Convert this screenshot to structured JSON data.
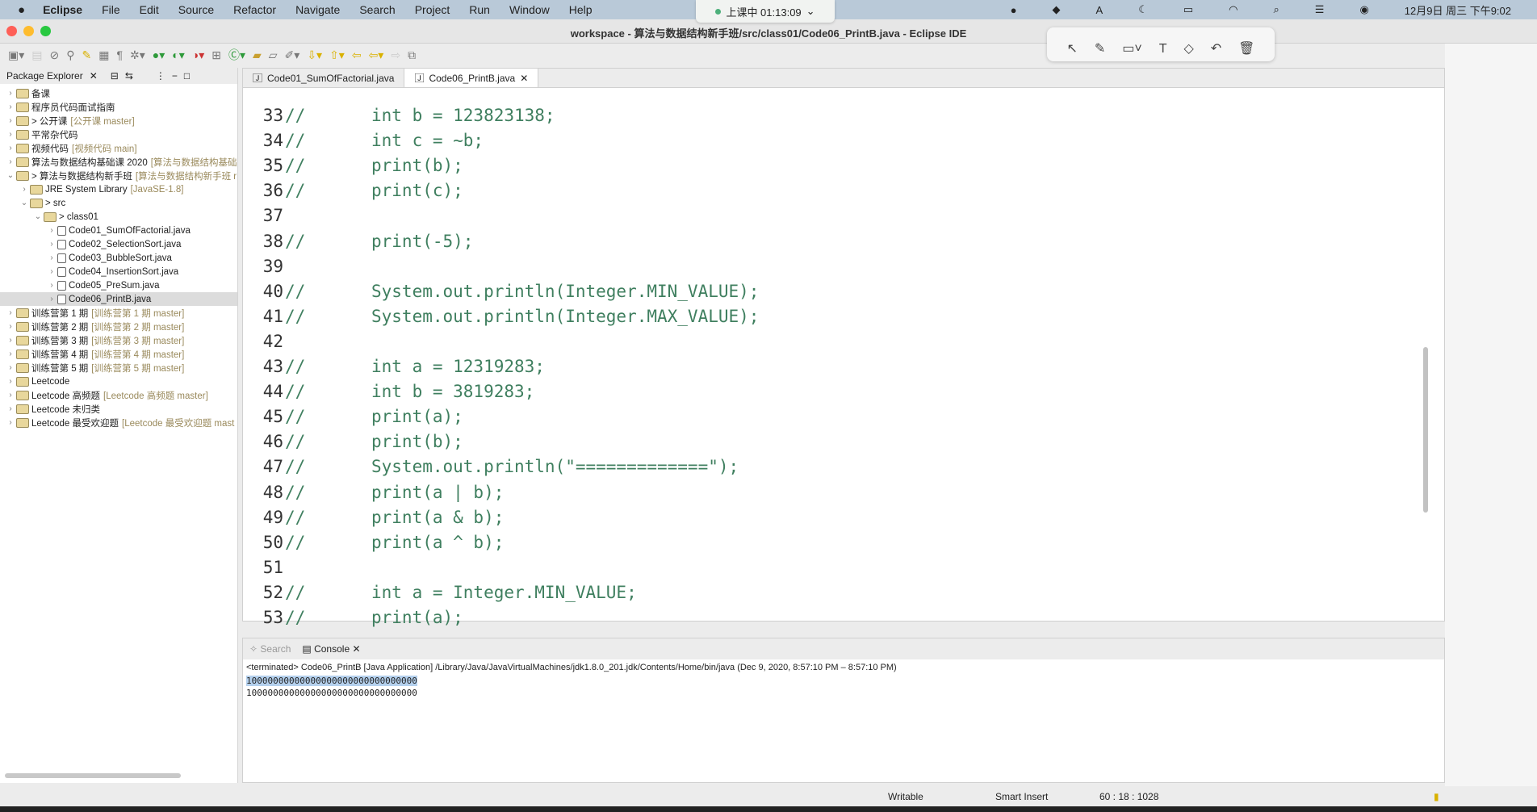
{
  "menubar": {
    "apple": "",
    "app": "Eclipse",
    "items": [
      "File",
      "Edit",
      "Source",
      "Refactor",
      "Navigate",
      "Search",
      "Project",
      "Run",
      "Window",
      "Help"
    ],
    "clock": "12月9日 周三 下午9:02"
  },
  "timer": {
    "label": "上课中 01:13:09",
    "chevron": "⌄"
  },
  "window": {
    "title": "workspace - 算法与数据结构新手班/src/class01/Code06_PrintB.java - Eclipse IDE"
  },
  "annotation_tools": [
    "select-arrow",
    "pen",
    "rectangle",
    "text",
    "eraser",
    "undo",
    "trash"
  ],
  "package_explorer": {
    "title": "Package Explorer",
    "items": [
      {
        "label": "备课",
        "dec": "",
        "level": 0,
        "open": false
      },
      {
        "label": "程序员代码面试指南",
        "dec": "",
        "level": 0,
        "open": false
      },
      {
        "label": "> 公开课",
        "dec": "[公开课 master]",
        "level": 0,
        "open": false
      },
      {
        "label": "平常杂代码",
        "dec": "",
        "level": 0,
        "open": false
      },
      {
        "label": "视频代码",
        "dec": "[视频代码 main]",
        "level": 0,
        "open": false
      },
      {
        "label": "算法与数据结构基础课 2020",
        "dec": "[算法与数据结构基础",
        "level": 0,
        "open": false
      },
      {
        "label": "> 算法与数据结构新手班",
        "dec": "[算法与数据结构新手班 r",
        "level": 0,
        "open": true
      },
      {
        "label": "JRE System Library",
        "dec": "[JavaSE-1.8]",
        "level": 1,
        "open": false
      },
      {
        "label": "> src",
        "dec": "",
        "level": 1,
        "open": true
      },
      {
        "label": "> class01",
        "dec": "",
        "level": 2,
        "open": true
      },
      {
        "label": "Code01_SumOfFactorial.java",
        "dec": "",
        "level": 3,
        "open": false,
        "file": true
      },
      {
        "label": "Code02_SelectionSort.java",
        "dec": "",
        "level": 3,
        "open": false,
        "file": true
      },
      {
        "label": "Code03_BubbleSort.java",
        "dec": "",
        "level": 3,
        "open": false,
        "file": true
      },
      {
        "label": "Code04_InsertionSort.java",
        "dec": "",
        "level": 3,
        "open": false,
        "file": true
      },
      {
        "label": "Code05_PreSum.java",
        "dec": "",
        "level": 3,
        "open": false,
        "file": true
      },
      {
        "label": "Code06_PrintB.java",
        "dec": "",
        "level": 3,
        "open": false,
        "file": true,
        "selected": true
      },
      {
        "label": "训练营第 1 期",
        "dec": "[训练营第 1 期 master]",
        "level": 0,
        "open": false
      },
      {
        "label": "训练营第 2 期",
        "dec": "[训练营第 2 期 master]",
        "level": 0,
        "open": false
      },
      {
        "label": "训练营第 3 期",
        "dec": "[训练营第 3 期 master]",
        "level": 0,
        "open": false
      },
      {
        "label": "训练营第 4 期",
        "dec": "[训练营第 4 期 master]",
        "level": 0,
        "open": false
      },
      {
        "label": "训练营第 5 期",
        "dec": "[训练营第 5 期 master]",
        "level": 0,
        "open": false
      },
      {
        "label": "Leetcode",
        "dec": "",
        "level": 0,
        "open": false
      },
      {
        "label": "Leetcode 高频题",
        "dec": "[Leetcode 高频题 master]",
        "level": 0,
        "open": false
      },
      {
        "label": "Leetcode 未归类",
        "dec": "",
        "level": 0,
        "open": false
      },
      {
        "label": "Leetcode 最受欢迎题",
        "dec": "[Leetcode 最受欢迎题 mast",
        "level": 0,
        "open": false
      }
    ]
  },
  "editor": {
    "tabs": [
      {
        "label": "Code01_SumOfFactorial.java",
        "active": false
      },
      {
        "label": "Code06_PrintB.java",
        "active": true
      }
    ],
    "lines": [
      {
        "n": "33",
        "c": "//",
        "t": "int b = 123823138;"
      },
      {
        "n": "34",
        "c": "//",
        "t": "int c = ~b;"
      },
      {
        "n": "35",
        "c": "//",
        "t": "print(b);"
      },
      {
        "n": "36",
        "c": "//",
        "t": "print(c);"
      },
      {
        "n": "37",
        "c": "",
        "t": ""
      },
      {
        "n": "38",
        "c": "//",
        "t": "print(-5);"
      },
      {
        "n": "39",
        "c": "",
        "t": ""
      },
      {
        "n": "40",
        "c": "//",
        "t": "System.out.println(Integer.MIN_VALUE);"
      },
      {
        "n": "41",
        "c": "//",
        "t": "System.out.println(Integer.MAX_VALUE);"
      },
      {
        "n": "42",
        "c": "",
        "t": ""
      },
      {
        "n": "43",
        "c": "//",
        "t": "int a = 12319283;"
      },
      {
        "n": "44",
        "c": "//",
        "t": "int b = 3819283;"
      },
      {
        "n": "45",
        "c": "//",
        "t": "print(a);"
      },
      {
        "n": "46",
        "c": "//",
        "t": "print(b);"
      },
      {
        "n": "47",
        "c": "//",
        "t": "System.out.println(\"=============\");"
      },
      {
        "n": "48",
        "c": "//",
        "t": "print(a | b);"
      },
      {
        "n": "49",
        "c": "//",
        "t": "print(a & b);"
      },
      {
        "n": "50",
        "c": "//",
        "t": "print(a ^ b);"
      },
      {
        "n": "51",
        "c": "",
        "t": ""
      },
      {
        "n": "52",
        "c": "//",
        "t": "int a = Integer.MIN_VALUE;"
      },
      {
        "n": "53",
        "c": "//",
        "t": "print(a);"
      }
    ]
  },
  "console": {
    "tabs": [
      "Search",
      "Console"
    ],
    "info": "<terminated> Code06_PrintB [Java Application] /Library/Java/JavaVirtualMachines/jdk1.8.0_201.jdk/Contents/Home/bin/java  (Dec 9, 2020, 8:57:10 PM – 8:57:10 PM)",
    "output": [
      "10000000000000000000000000000000",
      "10000000000000000000000000000000"
    ]
  },
  "statusbar": {
    "writable": "Writable",
    "insert_mode": "Smart Insert",
    "position": "60 : 18 : 1028"
  }
}
